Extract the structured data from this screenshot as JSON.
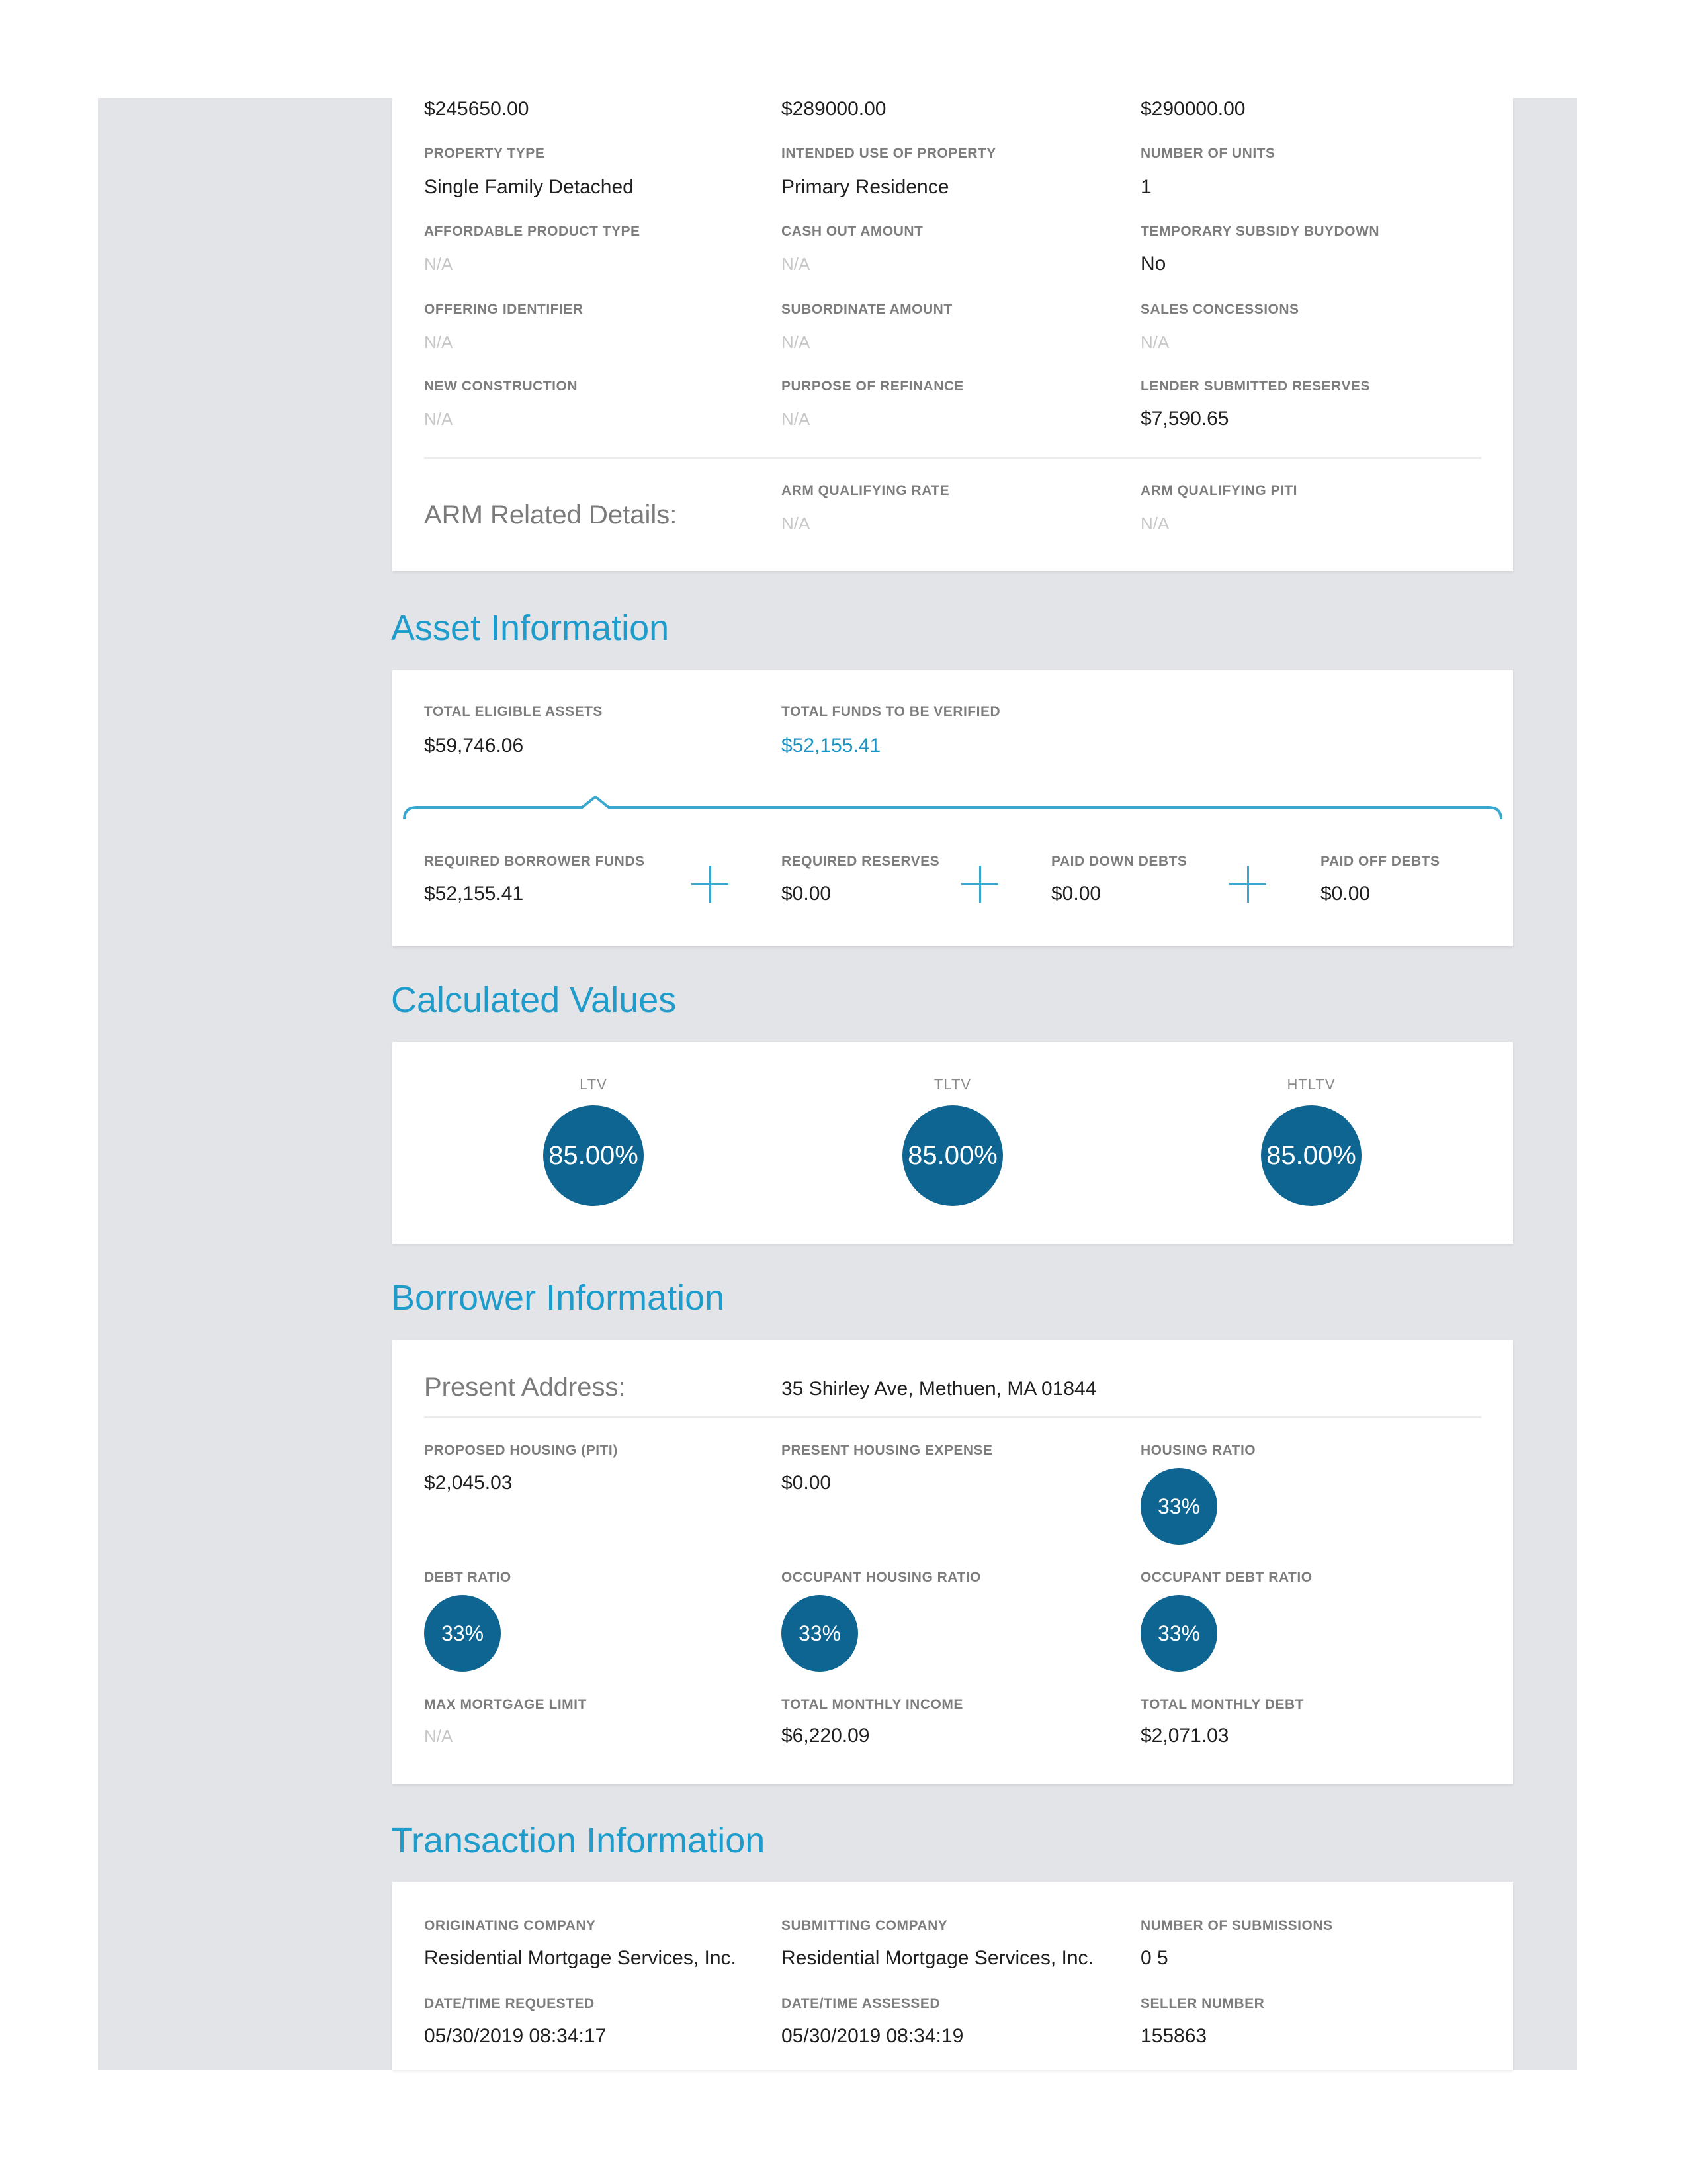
{
  "loan_card": {
    "top_values": [
      "$245650.00",
      "$289000.00",
      "$290000.00"
    ],
    "fields": [
      {
        "label": "PROPERTY TYPE",
        "value": "Single Family Detached"
      },
      {
        "label": "INTENDED USE OF PROPERTY",
        "value": "Primary Residence"
      },
      {
        "label": "NUMBER OF UNITS",
        "value": "1"
      },
      {
        "label": "AFFORDABLE PRODUCT TYPE",
        "value": "N/A"
      },
      {
        "label": "CASH OUT AMOUNT",
        "value": "N/A"
      },
      {
        "label": "TEMPORARY SUBSIDY BUYDOWN",
        "value": "No"
      },
      {
        "label": "OFFERING IDENTIFIER",
        "value": "N/A"
      },
      {
        "label": "SUBORDINATE AMOUNT",
        "value": "N/A"
      },
      {
        "label": "SALES CONCESSIONS",
        "value": "N/A"
      },
      {
        "label": "NEW CONSTRUCTION",
        "value": "N/A"
      },
      {
        "label": "PURPOSE OF REFINANCE",
        "value": "N/A"
      },
      {
        "label": "LENDER SUBMITTED RESERVES",
        "value": "$7,590.65"
      }
    ],
    "arm": {
      "title": "ARM Related Details:",
      "rate_label": "ARM QUALIFYING RATE",
      "rate_value": "N/A",
      "piti_label": "ARM QUALIFYING PITI",
      "piti_value": "N/A"
    }
  },
  "asset": {
    "title": "Asset Information",
    "total_eligible_label": "TOTAL ELIGIBLE ASSETS",
    "total_eligible_value": "$59,746.06",
    "total_funds_label": "TOTAL FUNDS TO BE VERIFIED",
    "total_funds_value": "$52,155.41",
    "items": [
      {
        "label": "REQUIRED BORROWER FUNDS",
        "value": "$52,155.41"
      },
      {
        "label": "REQUIRED RESERVES",
        "value": "$0.00"
      },
      {
        "label": "PAID DOWN DEBTS",
        "value": "$0.00"
      },
      {
        "label": "PAID OFF DEBTS",
        "value": "$0.00"
      }
    ]
  },
  "calculated": {
    "title": "Calculated Values",
    "items": [
      {
        "label": "LTV",
        "value": "85.00%"
      },
      {
        "label": "TLTV",
        "value": "85.00%"
      },
      {
        "label": "HTLTV",
        "value": "85.00%"
      }
    ]
  },
  "borrower": {
    "title": "Borrower Information",
    "address_label": "Present Address:",
    "address_value": "35 Shirley Ave, Methuen, MA 01844",
    "proposed_label": "PROPOSED HOUSING (PITI)",
    "proposed_value": "$2,045.03",
    "present_exp_label": "PRESENT HOUSING EXPENSE",
    "present_exp_value": "$0.00",
    "housing_ratio_label": "HOUSING RATIO",
    "housing_ratio_value": "33%",
    "debt_ratio_label": "DEBT RATIO",
    "debt_ratio_value": "33%",
    "occ_housing_label": "OCCUPANT HOUSING RATIO",
    "occ_housing_value": "33%",
    "occ_debt_label": "OCCUPANT DEBT RATIO",
    "occ_debt_value": "33%",
    "max_mortgage_label": "MAX MORTGAGE LIMIT",
    "max_mortgage_value": "N/A",
    "income_label": "TOTAL MONTHLY INCOME",
    "income_value": "$6,220.09",
    "debt_label": "TOTAL MONTHLY DEBT",
    "debt_value": "$2,071.03"
  },
  "transaction": {
    "title": "Transaction Information",
    "orig_label": "ORIGINATING COMPANY",
    "orig_value": "Residential Mortgage Services, Inc.",
    "sub_label": "SUBMITTING COMPANY",
    "sub_value": "Residential Mortgage Services, Inc.",
    "num_label": "NUMBER OF SUBMISSIONS",
    "num_value": "0 5",
    "req_label": "DATE/TIME REQUESTED",
    "req_value": "05/30/2019 08:34:17",
    "assessed_label": "DATE/TIME ASSESSED",
    "assessed_value": "05/30/2019 08:34:19",
    "seller_label": "SELLER NUMBER",
    "seller_value": "155863"
  },
  "colors": {
    "accent": "#1e9ccb",
    "circle": "#0e6591",
    "background": "#e3e4e8"
  }
}
